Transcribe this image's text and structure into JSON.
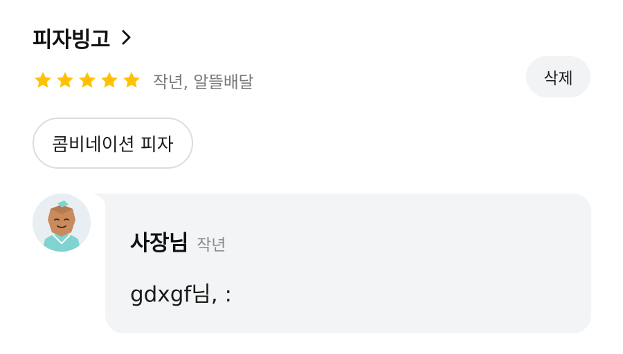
{
  "store": {
    "name": "피자빙고"
  },
  "review": {
    "rating": 5,
    "max_rating": 5,
    "meta": "작년, 알뜰배달",
    "delete_label": "삭제",
    "menu_item": "콤비네이션 피자"
  },
  "reply": {
    "author": "사장님",
    "time": "작년",
    "text": "gdxgf님, :"
  },
  "colors": {
    "star": "#ffc107",
    "bubble_bg": "#f3f4f6",
    "button_bg": "#f2f3f5",
    "chip_border": "#dcdcdc",
    "meta_text": "#7a7a7a"
  },
  "icons": {
    "chevron": "chevron-right-icon",
    "star": "star-icon",
    "avatar": "owner-avatar"
  }
}
